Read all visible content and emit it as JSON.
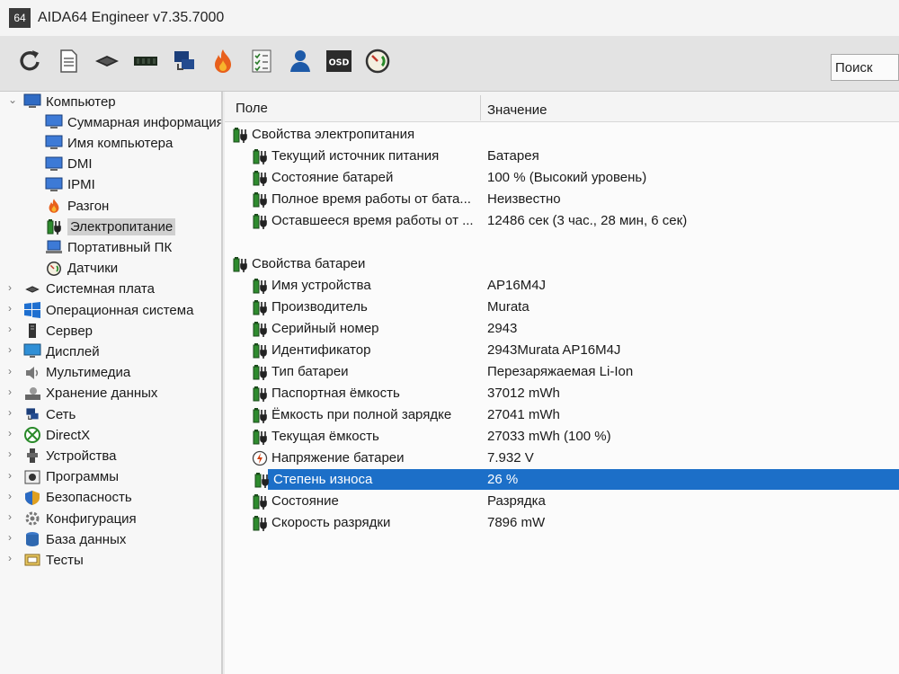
{
  "window": {
    "app_icon_text": "64",
    "title": "AIDA64 Engineer v7.35.7000"
  },
  "toolbar": {
    "buttons": [
      {
        "name": "refresh-icon"
      },
      {
        "name": "report-icon"
      },
      {
        "name": "motherboard-icon"
      },
      {
        "name": "memory-icon"
      },
      {
        "name": "network-icon"
      },
      {
        "name": "flame-icon"
      },
      {
        "name": "checklist-icon"
      },
      {
        "name": "user-icon"
      },
      {
        "name": "osd-icon",
        "text": "OSD"
      },
      {
        "name": "gauge-icon"
      }
    ],
    "search_label": "Поиск"
  },
  "sidebar": {
    "items": [
      {
        "label": "Компьютер",
        "icon": "computer-icon",
        "level": 0,
        "arrow": "⌄"
      },
      {
        "label": "Суммарная информация",
        "icon": "monitor-icon",
        "level": 1
      },
      {
        "label": "Имя компьютера",
        "icon": "monitor-icon",
        "level": 1
      },
      {
        "label": "DMI",
        "icon": "monitor-icon",
        "level": 1
      },
      {
        "label": "IPMI",
        "icon": "monitor-icon",
        "level": 1
      },
      {
        "label": "Разгон",
        "icon": "flame-icon",
        "level": 1
      },
      {
        "label": "Электропитание",
        "icon": "battery-icon",
        "level": 1,
        "selected": true
      },
      {
        "label": "Портативный ПК",
        "icon": "laptop-icon",
        "level": 1
      },
      {
        "label": "Датчики",
        "icon": "gauge-icon",
        "level": 1
      },
      {
        "label": "Системная плата",
        "icon": "motherboard-icon",
        "level": 0,
        "arrow": "›"
      },
      {
        "label": "Операционная система",
        "icon": "windows-icon",
        "level": 0,
        "arrow": "›"
      },
      {
        "label": "Сервер",
        "icon": "server-icon",
        "level": 0,
        "arrow": "›"
      },
      {
        "label": "Дисплей",
        "icon": "display-icon",
        "level": 0,
        "arrow": "›"
      },
      {
        "label": "Мультимедиа",
        "icon": "speaker-icon",
        "level": 0,
        "arrow": "›"
      },
      {
        "label": "Хранение данных",
        "icon": "storage-icon",
        "level": 0,
        "arrow": "›"
      },
      {
        "label": "Сеть",
        "icon": "network-icon",
        "level": 0,
        "arrow": "›"
      },
      {
        "label": "DirectX",
        "icon": "xbox-icon",
        "level": 0,
        "arrow": "›"
      },
      {
        "label": "Устройства",
        "icon": "devices-icon",
        "level": 0,
        "arrow": "›"
      },
      {
        "label": "Программы",
        "icon": "programs-icon",
        "level": 0,
        "arrow": "›"
      },
      {
        "label": "Безопасность",
        "icon": "shield-icon",
        "level": 0,
        "arrow": "›"
      },
      {
        "label": "Конфигурация",
        "icon": "config-icon",
        "level": 0,
        "arrow": "›"
      },
      {
        "label": "База данных",
        "icon": "database-icon",
        "level": 0,
        "arrow": "›"
      },
      {
        "label": "Тесты",
        "icon": "tests-icon",
        "level": 0,
        "arrow": "›"
      }
    ]
  },
  "table": {
    "col_field": "Поле",
    "col_value": "Значение",
    "rows": [
      {
        "type": "group",
        "field": "Свойства электропитания",
        "icon": "battery-icon"
      },
      {
        "type": "item",
        "field": "Текущий источник питания",
        "value": "Батарея",
        "icon": "battery-icon"
      },
      {
        "type": "item",
        "field": "Состояние батарей",
        "value": "100 % (Высокий уровень)",
        "icon": "battery-icon"
      },
      {
        "type": "item",
        "field": "Полное время работы от бата...",
        "value": "Неизвестно",
        "icon": "battery-icon"
      },
      {
        "type": "item",
        "field": "Оставшееся время работы от ...",
        "value": "12486 сек (3 час., 28 мин, 6 сек)",
        "icon": "battery-icon"
      },
      {
        "type": "spacer"
      },
      {
        "type": "group",
        "field": "Свойства батареи",
        "icon": "battery-icon"
      },
      {
        "type": "item",
        "field": "Имя устройства",
        "value": "AP16M4J",
        "icon": "battery-icon"
      },
      {
        "type": "item",
        "field": "Производитель",
        "value": "Murata",
        "icon": "battery-icon"
      },
      {
        "type": "item",
        "field": "Серийный номер",
        "value": "2943",
        "icon": "battery-icon"
      },
      {
        "type": "item",
        "field": "Идентификатор",
        "value": "2943Murata AP16M4J",
        "icon": "battery-icon"
      },
      {
        "type": "item",
        "field": "Тип батареи",
        "value": "Перезаряжаемая Li-Ion",
        "icon": "battery-icon"
      },
      {
        "type": "item",
        "field": "Паспортная ёмкость",
        "value": "37012 mWh",
        "icon": "battery-icon"
      },
      {
        "type": "item",
        "field": "Ёмкость при полной зарядке",
        "value": "27041 mWh",
        "icon": "battery-icon"
      },
      {
        "type": "item",
        "field": "Текущая ёмкость",
        "value": "27033 mWh  (100 %)",
        "icon": "battery-icon"
      },
      {
        "type": "item",
        "field": "Напряжение батареи",
        "value": "7.932 V",
        "icon": "voltage-icon"
      },
      {
        "type": "item",
        "field": "Степень износа",
        "value": "26 %",
        "icon": "battery-icon",
        "selected": true
      },
      {
        "type": "item",
        "field": "Состояние",
        "value": "Разрядка",
        "icon": "battery-icon"
      },
      {
        "type": "item",
        "field": "Скорость разрядки",
        "value": "7896 mW",
        "icon": "battery-icon"
      }
    ]
  }
}
